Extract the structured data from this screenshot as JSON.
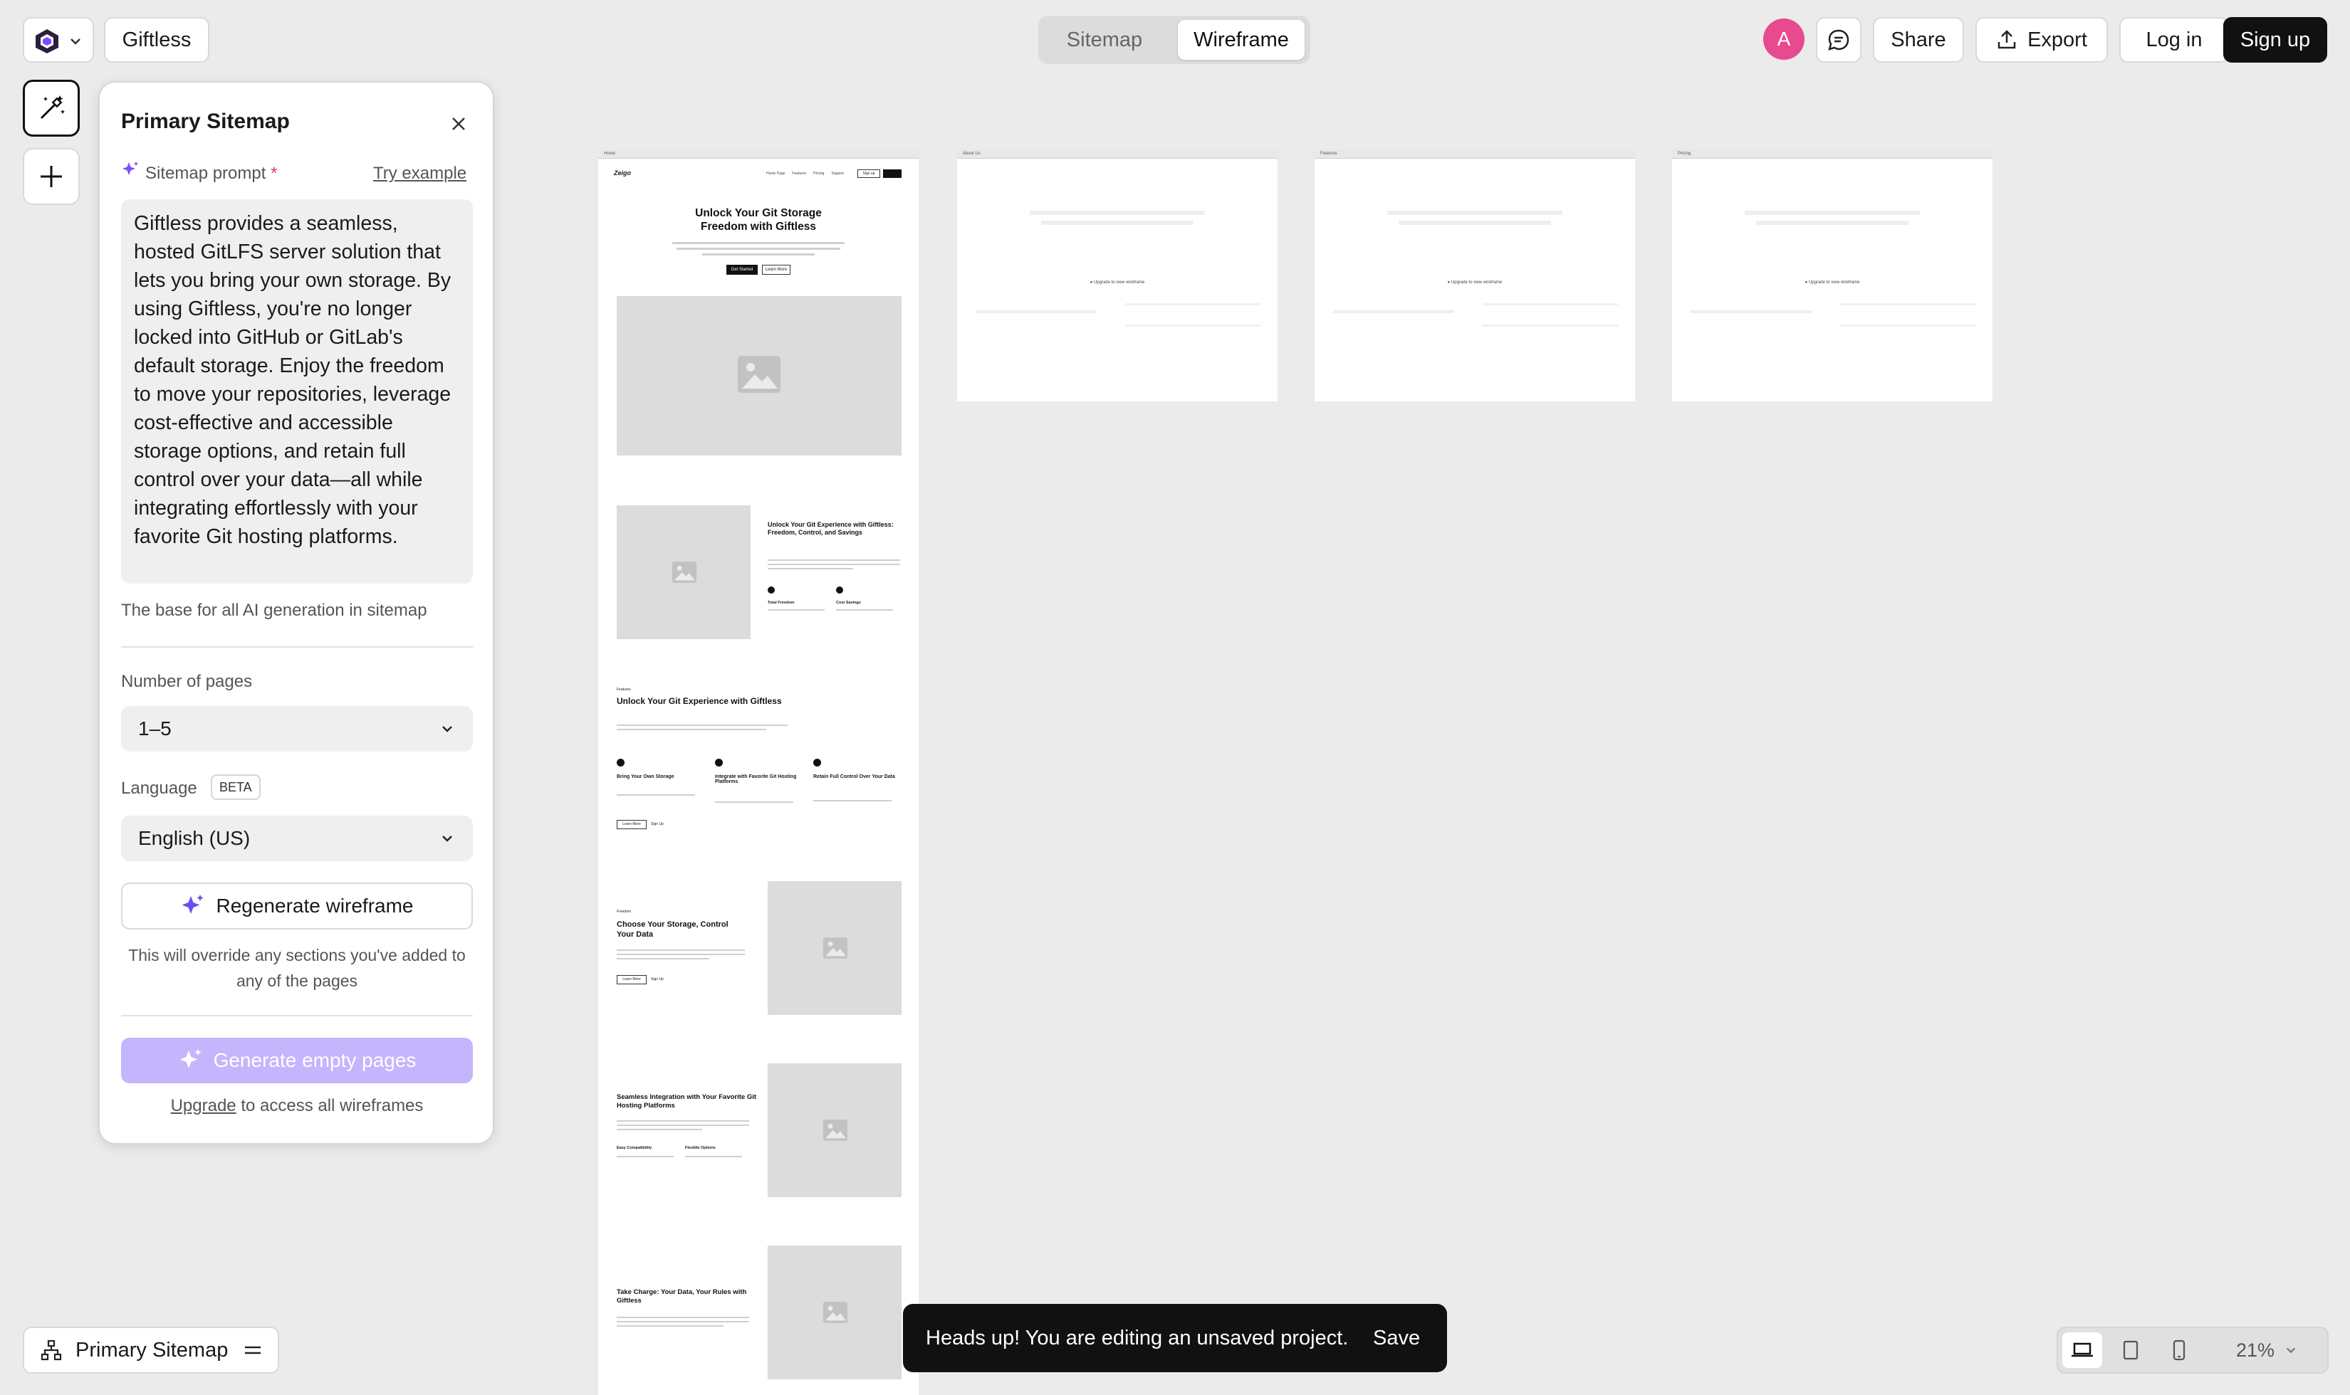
{
  "app": {
    "project_name": "Giftless"
  },
  "view_tabs": [
    {
      "label": "Sitemap",
      "active": false
    },
    {
      "label": "Wireframe",
      "active": true
    }
  ],
  "header": {
    "avatar_initial": "A",
    "share_label": "Share",
    "export_label": "Export",
    "login_label": "Log in",
    "signup_label": "Sign up"
  },
  "panel": {
    "title": "Primary Sitemap",
    "prompt_label": "Sitemap prompt",
    "required_mark": "*",
    "try_example": "Try example",
    "prompt_text": "Giftless provides a seamless, hosted GitLFS server solution that lets you bring your own storage. By using Giftless, you're no longer locked into GitHub or GitLab's default storage. Enjoy the freedom to move your repositories, leverage cost-effective and accessible storage options, and retain full control over your data—all while integrating effortlessly with your favorite Git hosting platforms.",
    "prompt_hint": "The base for all AI generation in sitemap",
    "pages_label": "Number of pages",
    "pages_value": "1–5",
    "language_label": "Language",
    "language_badge": "BETA",
    "language_value": "English (US)",
    "regenerate_label": "Regenerate wireframe",
    "regenerate_note": "This will override any sections you've added to any of the pages",
    "generate_label": "Generate empty pages",
    "upgrade_link": "Upgrade",
    "upgrade_rest": " to access all wireframes"
  },
  "bottom_left": {
    "sitemap_label": "Primary Sitemap"
  },
  "toast": {
    "message": "Heads up! You are editing an unsaved project.",
    "save_label": "Save"
  },
  "zoom": {
    "value": "21%"
  },
  "wireframes": {
    "home": {
      "tab": "Home",
      "logo": "Zeigo",
      "nav": [
        "Home Page",
        "Features",
        "Pricing",
        "Support"
      ],
      "nav_signin": "Sign up",
      "hero_title_1": "Unlock Your Git Storage",
      "hero_title_2": "Freedom with Giftless",
      "hero_btn_1": "Get Started",
      "hero_btn_2": "Learn More",
      "s2_title": "Unlock Your Git Experience with Giftless: Freedom, Control, and Savings",
      "s2_f1": "Total Freedom",
      "s2_f2": "Cost Savings",
      "s3_eyebrow": "Features",
      "s3_title": "Unlock Your Git Experience with Giftless",
      "s3_f1": "Bring Your Own Storage",
      "s3_f2": "Integrate with Favorite Git Hosting Platforms",
      "s3_f3": "Retain Full Control Over Your Data",
      "s3_btn_1": "Learn More",
      "s3_btn_2": "Sign Up",
      "s4_eyebrow": "Freedom",
      "s4_title": "Choose Your Storage, Control Your Data",
      "s4_btn_1": "Learn More",
      "s4_btn_2": "Sign Up",
      "s5_title": "Seamless Integration with Your Favorite Git Hosting Platforms",
      "s5_f1": "Easy Compatibility",
      "s5_f2": "Flexible Options",
      "s6_title": "Take Charge: Your Data, Your Rules with Giftless"
    },
    "locked": [
      {
        "tab": "About Us",
        "upgrade": "Upgrade to view wireframe"
      },
      {
        "tab": "Features",
        "upgrade": "Upgrade to view wireframe"
      },
      {
        "tab": "Pricing",
        "upgrade": "Upgrade to view wireframe"
      }
    ]
  }
}
